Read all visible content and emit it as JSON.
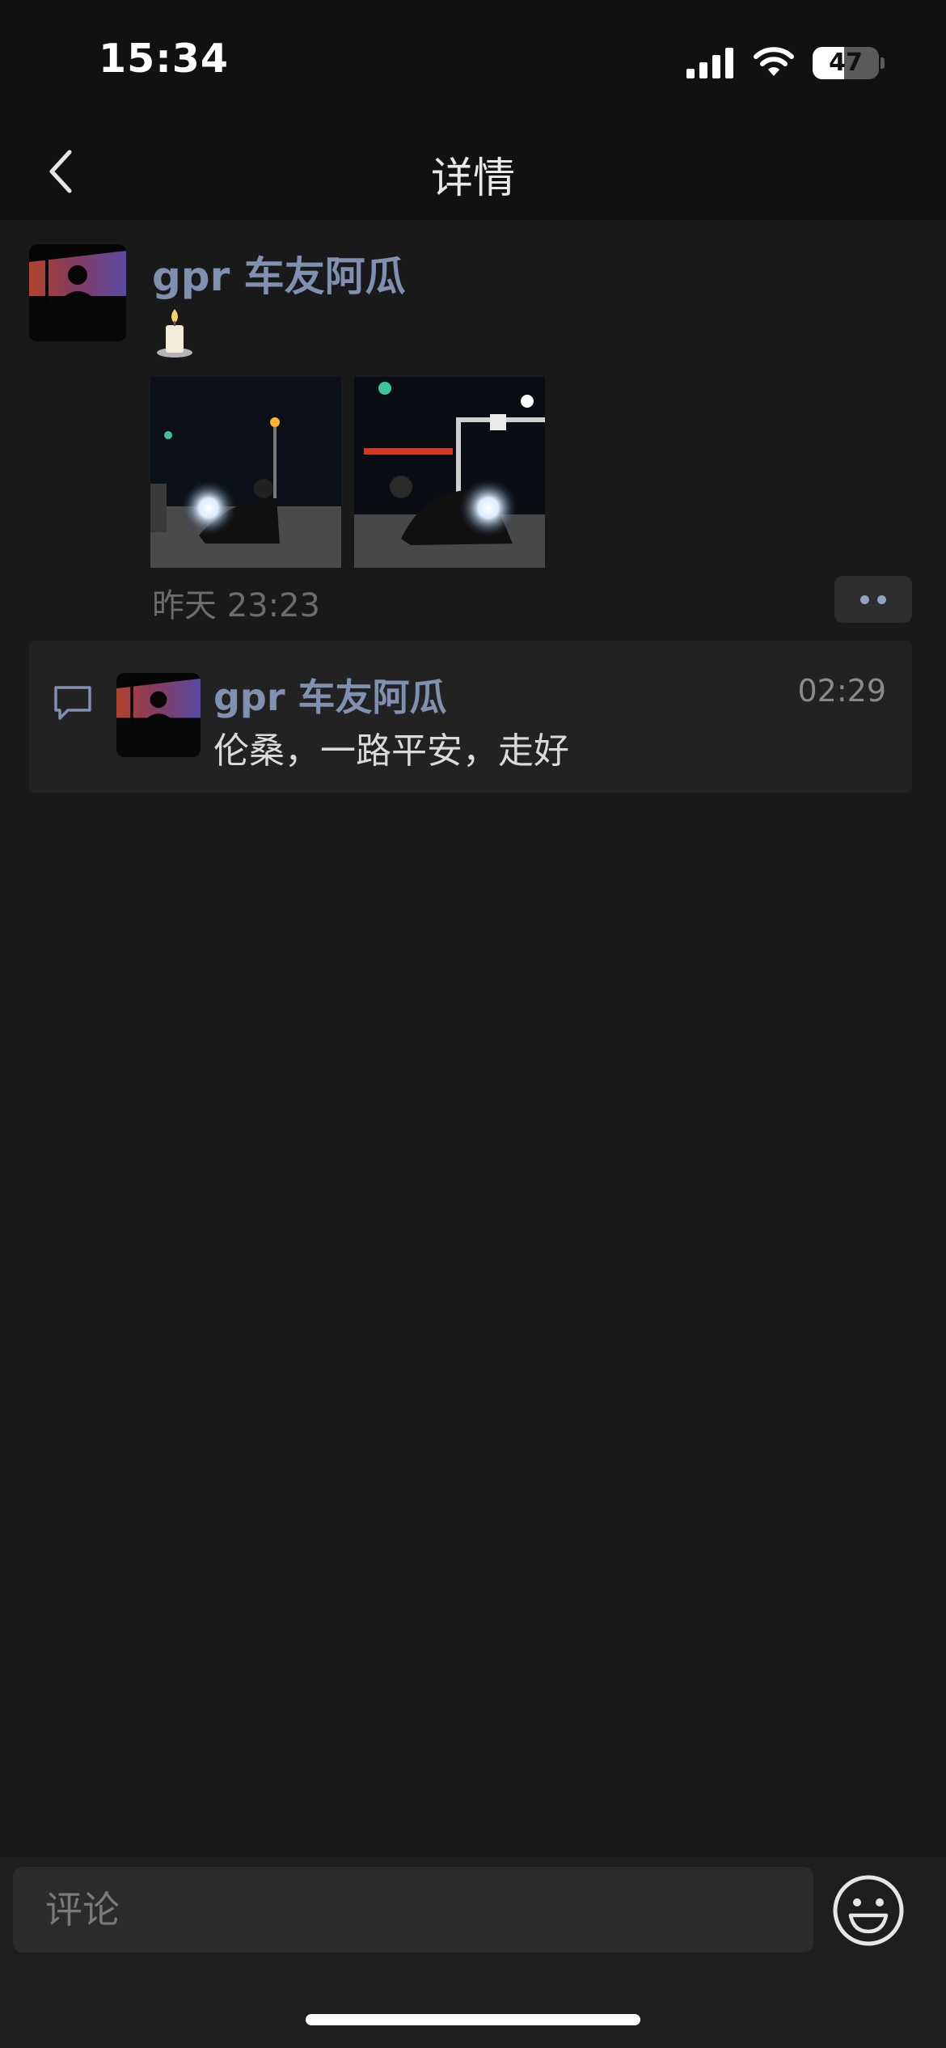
{
  "status_bar": {
    "time": "15:34",
    "battery_level": "47",
    "icons": [
      "cellular-signal-icon",
      "wifi-icon",
      "battery-icon"
    ]
  },
  "nav": {
    "title": "详情",
    "back_icon": "chevron-left-icon"
  },
  "post": {
    "author": "gpr 车友阿瓜",
    "emoji": "candle",
    "images": [
      "motorcycle-night-photo",
      "motorcycle-night-photo"
    ],
    "time": "昨天 23:23",
    "more_icon": "more-dots-icon"
  },
  "comments": [
    {
      "author": "gpr 车友阿瓜",
      "time": "02:29",
      "text": "伦桑，一路平安，走好"
    }
  ],
  "input": {
    "placeholder": "评论",
    "emoji_icon": "smiley-icon"
  },
  "colors": {
    "background": "#191919",
    "bar": "#111111",
    "name_link": "#7f90b0",
    "comment_panel": "#222222"
  }
}
